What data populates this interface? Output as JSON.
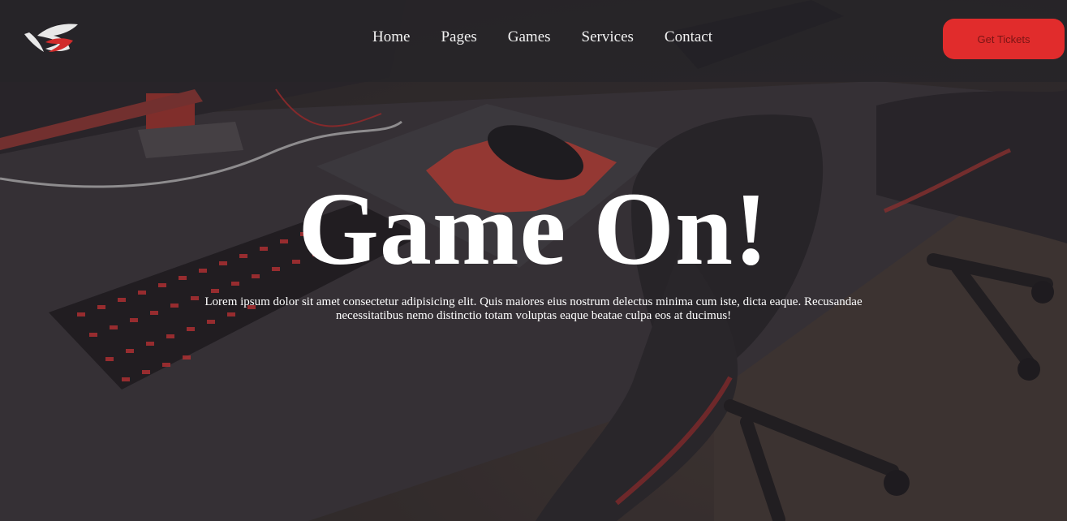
{
  "header": {
    "nav": [
      {
        "label": "Home"
      },
      {
        "label": "Pages"
      },
      {
        "label": "Games"
      },
      {
        "label": "Services"
      },
      {
        "label": "Contact"
      }
    ],
    "cta_label": "Get Tickets"
  },
  "hero": {
    "title": "Game On!",
    "text": "Lorem ipsum dolor sit amet consectetur adipisicing elit. Quis maiores eius nostrum delectus minima cum iste, dicta eaque. Recusandae necessitatibus nemo distinctio totam voluptas eaque beatae culpa eos at ducimus!"
  },
  "colors": {
    "accent": "#e12c2c",
    "header_bg": "#262428",
    "text": "#ffffff"
  },
  "icons": {
    "logo": "gaming-brand-logo-icon"
  }
}
